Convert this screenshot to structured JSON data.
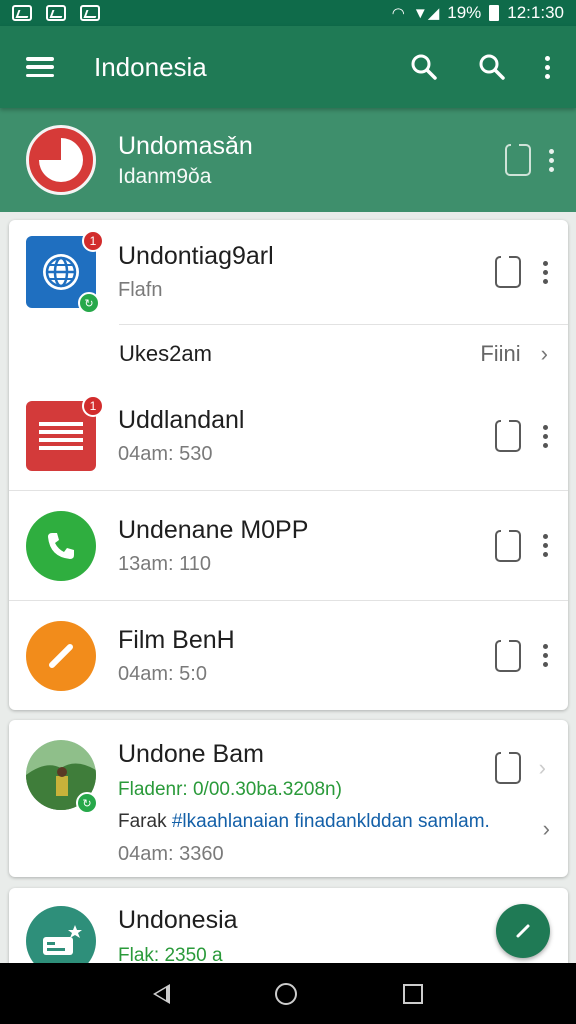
{
  "status_bar": {
    "battery_percent": "19%",
    "time": "12:1:30"
  },
  "app_bar": {
    "title": "Indonesia"
  },
  "banner": {
    "title": "Undomasǎn",
    "subtitle": "Idanm9ǒa"
  },
  "group1": {
    "items": [
      {
        "title": "Undontiag9arl",
        "subtitle": "Flafn",
        "badge": "1",
        "icon": "globe-icon"
      },
      {
        "title": "Uddlandanl",
        "subtitle": "04am: 530",
        "badge": "1",
        "icon": "list-icon"
      },
      {
        "title": "Undenane M0PP",
        "subtitle": "13am: 110",
        "icon": "phone-icon"
      },
      {
        "title": "Film BenH",
        "subtitle": "04am: 5:0",
        "icon": "pencil-icon"
      }
    ],
    "subrow": {
      "label": "Ukes2am",
      "meta": "Fiini"
    }
  },
  "group2": {
    "title": "Undone Bam",
    "line1": "Fladenr: 0/00.30ba.3208n)",
    "line2_prefix": "Farak ",
    "line2_tag": "#lkaahlanaian finadanklddan samlam.",
    "line3": "04am: 3360"
  },
  "group3": {
    "title": "Undonesia",
    "subtitle": "Flak: 2350 a"
  },
  "colors": {
    "primary": "#1f7a55",
    "banner": "#3e8f6c",
    "badge_red": "#d22c2c",
    "accent_green": "#27a84a"
  }
}
